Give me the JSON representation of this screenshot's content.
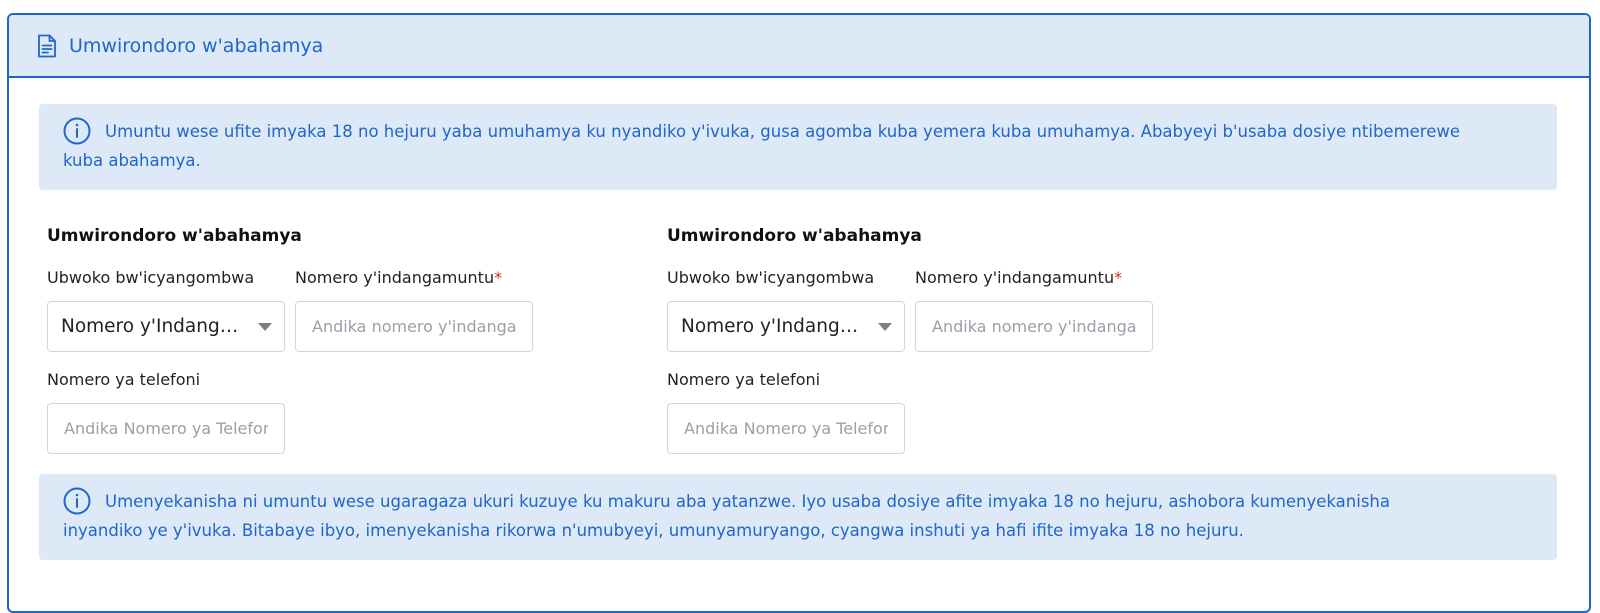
{
  "header": {
    "title": "Umwirondoro w'abahamya",
    "icon": "document-icon"
  },
  "alerts": {
    "top_text": "Umuntu wese ufite imyaka 18 no hejuru yaba umuhamya ku nyandiko y'ivuka, gusa agomba kuba yemera kuba umuhamya. Ababyeyi b'usaba dosiye ntibemerewe kuba abahamya.",
    "bottom_text": "Umenyekanisha ni umuntu wese ugaragaza ukuri kuzuye ku makuru aba yatanzwe. Iyo usaba dosiye afite imyaka 18 no hejuru, ashobora kumenyekanisha inyandiko ye y'ivuka. Bitabaye ibyo, imenyekanisha rikorwa n'umubyeyi, umunyamuryango, cyangwa inshuti ya hafi ifite imyaka 18 no hejuru.",
    "icon": "info-icon"
  },
  "witnesses": [
    {
      "section_title": "Umwirondoro w'abahamya",
      "doc_type_label": "Ubwoko bw'icyangombwa",
      "doc_type_value": "Nomero y'Indangamuntu",
      "id_label": "Nomero y'indangamuntu",
      "required_mark": "*",
      "id_placeholder": "Andika nomero y'indangamuntu",
      "phone_label": "Nomero ya telefoni",
      "phone_placeholder": "Andika Nomero ya Telefoni"
    },
    {
      "section_title": "Umwirondoro w'abahamya",
      "doc_type_label": "Ubwoko bw'icyangombwa",
      "doc_type_value": "Nomero y'Indangamuntu",
      "id_label": "Nomero y'indangamuntu",
      "required_mark": "*",
      "id_placeholder": "Andika nomero y'indangamuntu",
      "phone_label": "Nomero ya telefoni",
      "phone_placeholder": "Andika Nomero ya Telefoni"
    }
  ],
  "colors": {
    "accent": "#1f66cc",
    "alert_bg": "#dde9f7",
    "required": "#e02424"
  }
}
